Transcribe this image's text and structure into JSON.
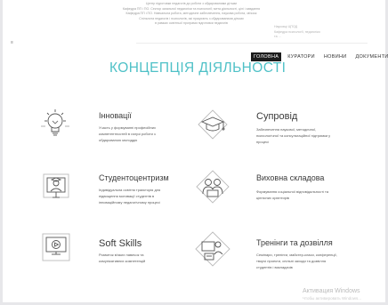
{
  "header": {
    "top_lines": [
      "Центр підготовки педагогів до роботи з обдарованими дітьми",
      "Кафедра ПП і ПО. Сектор загальної педагогіки та психології; мета діяльності, цілі і завдання",
      "Кафедра ПП і ПО. Навчальна робота, методичне забезпечення, наукова робота, зв'язок",
      "Спільнота педагогів і психологів, які працюють з обдарованими дітьми",
      "в рамках освітньої програми підготовки педагогів"
    ],
    "right_lines": [
      "Науковці ЦПОД",
      "Кафедра психології, педагогіки",
      "та ..."
    ]
  },
  "side_mark": "≡",
  "nav": {
    "items": [
      {
        "label": "ГОЛОВНА",
        "active": true
      },
      {
        "label": "КУРАТОРИ",
        "active": false
      },
      {
        "label": "НОВИНИ",
        "active": false
      },
      {
        "label": "ДОКУМЕНТИ",
        "active": false
      }
    ]
  },
  "page_title": "КОНЦЕПЦІЯ ДІЯЛЬНОСТІ",
  "cards": [
    {
      "title": "Інновації",
      "icon": "lightbulb-icon",
      "desc": "Участь у формуванні професійних компетентностей в галузі роботи з обдарованою молоддю"
    },
    {
      "title": "Супровід",
      "icon": "graduation-cap-icon",
      "desc": "Забезпечення наукової, методичної, психологічної та консультаційної підтримки у процесі"
    },
    {
      "title": "Студентоцентризм",
      "icon": "online-learning-icon",
      "desc": "Індивідуальна освітня траєкторія для підвищення мотивації студентів в інноваційному педагогічному процесі"
    },
    {
      "title": "Виховна складова",
      "icon": "people-icon",
      "desc": "Формування соціальної відповідальності та ціннісних орієнтирів"
    },
    {
      "title": "Soft Skills",
      "icon": "video-screen-icon",
      "desc": "Розвиток м'яких навичок та комунікативних компетенцій"
    },
    {
      "title": "Тренінги та дозвілля",
      "icon": "training-icon",
      "desc": "Семінари, тренінги, майстер-класи, конференції, творчі проекти, спільні заходи та дозвілля студентів і викладачів"
    }
  ],
  "watermark": {
    "line1": "Активация Windows",
    "line2": "Чтобы активировать Windows..."
  }
}
